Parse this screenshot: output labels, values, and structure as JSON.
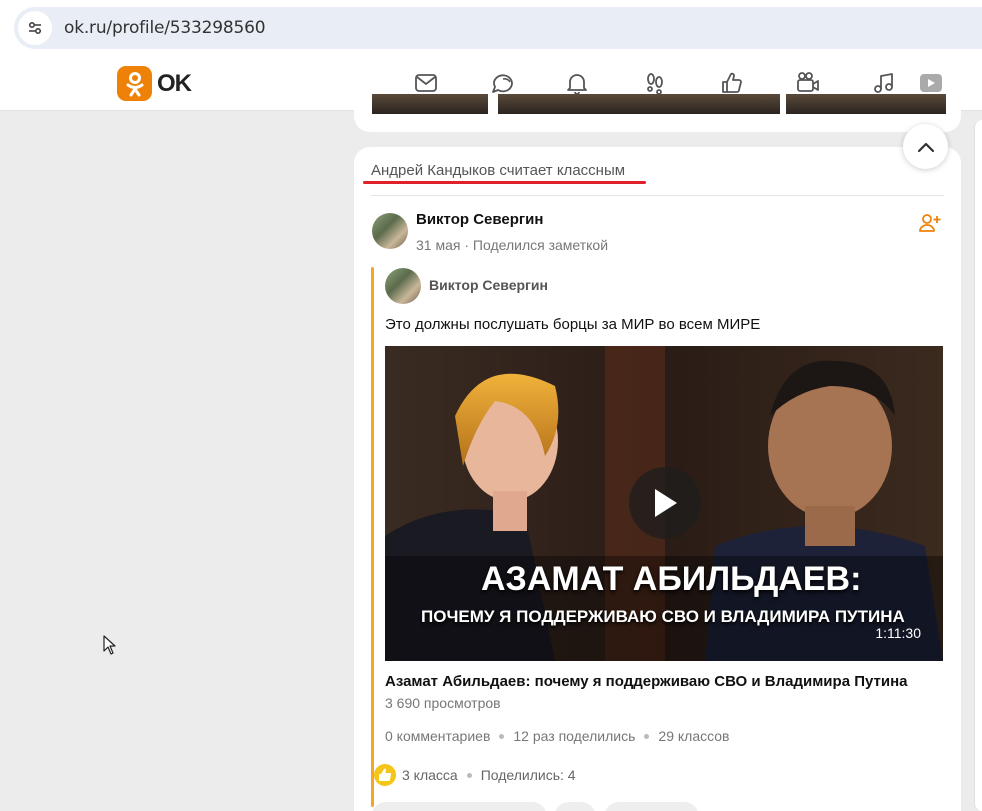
{
  "browser": {
    "url": "ok.ru/profile/533298560"
  },
  "header": {
    "logo_text": "OK",
    "brand_color": "#ee8208",
    "nav_icons": [
      "mail-icon",
      "chat-icon",
      "bell-icon",
      "footprints-icon",
      "thumbs-up-icon",
      "video-camera-icon",
      "music-note-icon",
      "video-play-icon"
    ]
  },
  "feed": {
    "topic": "Андрей Кандыков считает классным",
    "topic_underline_color": "#e0202a",
    "author": {
      "name": "Виктор Севергин",
      "date": "31 мая",
      "action": "Поделился заметкой"
    },
    "original_post": {
      "author_name": "Виктор Севергин",
      "text": "Это должны послушать борцы за МИР во всем МИРЕ",
      "video": {
        "overlay_title_line1": "АЗАМАТ  АБИЛЬДАЕВ:",
        "overlay_title_line2": "ПОЧЕМУ Я ПОДДЕРЖИВАЮ СВО И ВЛАДИМИРА ПУТИНА",
        "duration": "1:11:30",
        "title": "Азамат Абильдаев: почему я поддерживаю СВО и Владимира Путина",
        "views": "3 690 просмотров"
      },
      "stats": {
        "comments": "0 комментариев",
        "shares": "12 раз поделились",
        "likes": "29 классов"
      }
    },
    "reactions": {
      "likes": "3 класса",
      "shares": "Поделились: 4"
    }
  }
}
